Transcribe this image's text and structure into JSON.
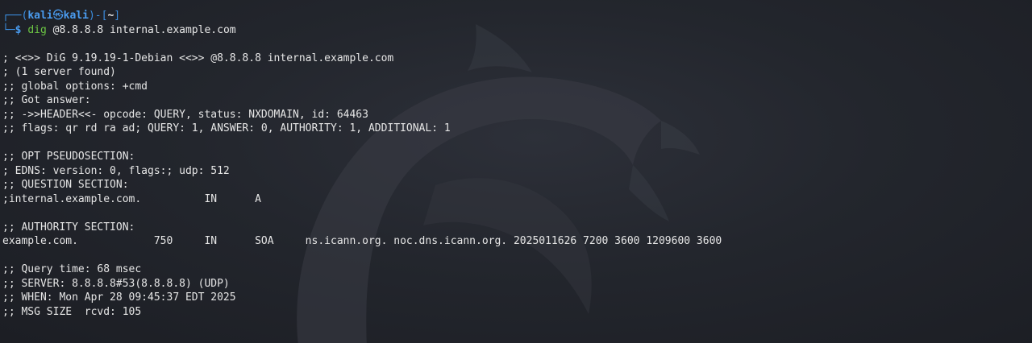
{
  "prompt": {
    "top_left": "┌──(",
    "user": "kali",
    "separator": "㉿",
    "host": "kali",
    "mid": ")-[",
    "dir": "~",
    "close": "]",
    "bottom_left": "└─",
    "dollar": "$",
    "command": "dig",
    "arguments": " @8.8.8.8 internal.example.com"
  },
  "output": [
    "; <<>> DiG 9.19.19-1-Debian <<>> @8.8.8.8 internal.example.com",
    "; (1 server found)",
    ";; global options: +cmd",
    ";; Got answer:",
    ";; ->>HEADER<<- opcode: QUERY, status: NXDOMAIN, id: 64463",
    ";; flags: qr rd ra ad; QUERY: 1, ANSWER: 0, AUTHORITY: 1, ADDITIONAL: 1",
    "",
    ";; OPT PSEUDOSECTION:",
    "; EDNS: version: 0, flags:; udp: 512",
    ";; QUESTION SECTION:",
    ";internal.example.com.          IN      A",
    "",
    ";; AUTHORITY SECTION:",
    "example.com.            750     IN      SOA     ns.icann.org. noc.dns.icann.org. 2025011626 7200 3600 1209600 3600",
    "",
    ";; Query time: 68 msec",
    ";; SERVER: 8.8.8.8#53(8.8.8.8) (UDP)",
    ";; WHEN: Mon Apr 28 09:45:37 EDT 2025",
    ";; MSG SIZE  rcvd: 105"
  ],
  "colors": {
    "background": "#23262d",
    "prompt_blue": "#4a9cf0",
    "command_green": "#6cc644",
    "text": "#e6e6e6"
  },
  "icons": {
    "background_logo": "kali-dragon-icon"
  }
}
